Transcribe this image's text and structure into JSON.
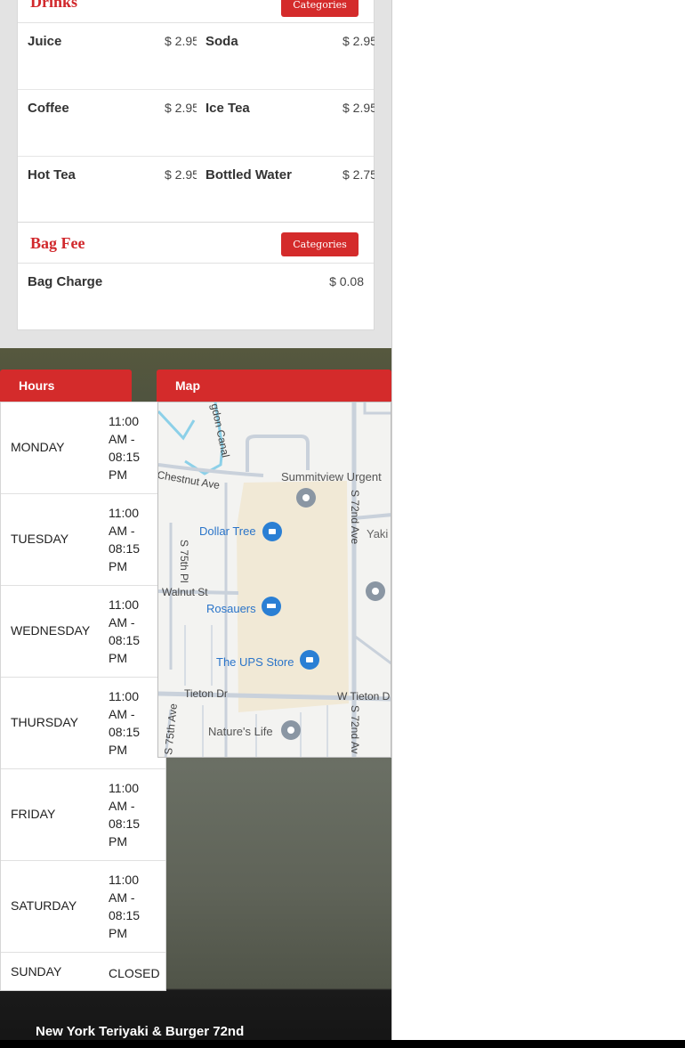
{
  "menu": {
    "categories_label": "Categories",
    "drinks": {
      "title": "Drinks",
      "rows": [
        [
          {
            "name": "Juice",
            "price": "$ 2.95"
          },
          {
            "name": "Soda",
            "price": "$ 2.95"
          }
        ],
        [
          {
            "name": "Coffee",
            "price": "$ 2.95"
          },
          {
            "name": "Ice Tea",
            "price": "$ 2.95"
          }
        ],
        [
          {
            "name": "Hot Tea",
            "price": "$ 2.95"
          },
          {
            "name": "Bottled Water",
            "price": "$ 2.75"
          }
        ]
      ]
    },
    "bag_fee": {
      "title": "Bag Fee",
      "items": [
        {
          "name": "Bag Charge",
          "price": "$ 0.08"
        }
      ]
    }
  },
  "tabs": {
    "hours": "Hours",
    "map": "Map"
  },
  "hours": [
    {
      "day": "MONDAY",
      "time": "11:00 AM - 08:15 PM"
    },
    {
      "day": "TUESDAY",
      "time": "11:00 AM - 08:15 PM"
    },
    {
      "day": "WEDNESDAY",
      "time": "11:00 AM - 08:15 PM"
    },
    {
      "day": "THURSDAY",
      "time": "11:00 AM - 08:15 PM"
    },
    {
      "day": "FRIDAY",
      "time": "11:00 AM - 08:15 PM"
    },
    {
      "day": "SATURDAY",
      "time": "11:00 AM - 08:15 PM"
    },
    {
      "day": "SUNDAY",
      "time": "CLOSED"
    }
  ],
  "map": {
    "places": {
      "summitview": "Summitview Urgent",
      "dollar_tree": "Dollar Tree",
      "rosauers": "Rosauers",
      "ups_store": "The UPS Store",
      "natures_life": "Nature's Life",
      "yakima": "Yaki"
    },
    "roads": {
      "canal": "gdon Canal",
      "chestnut": "Chestnut Ave",
      "walnut": "Walnut St",
      "tieton": "Tieton Dr",
      "w_tieton": "W Tieton D",
      "s72_top": "S 72nd Ave",
      "s72_bottom": "S 72nd Av",
      "s75pl": "S 75th Pl",
      "s75ave": "S 75th Ave"
    }
  },
  "footer": {
    "restaurant_name": "New York Teriyaki & Burger 72nd"
  }
}
